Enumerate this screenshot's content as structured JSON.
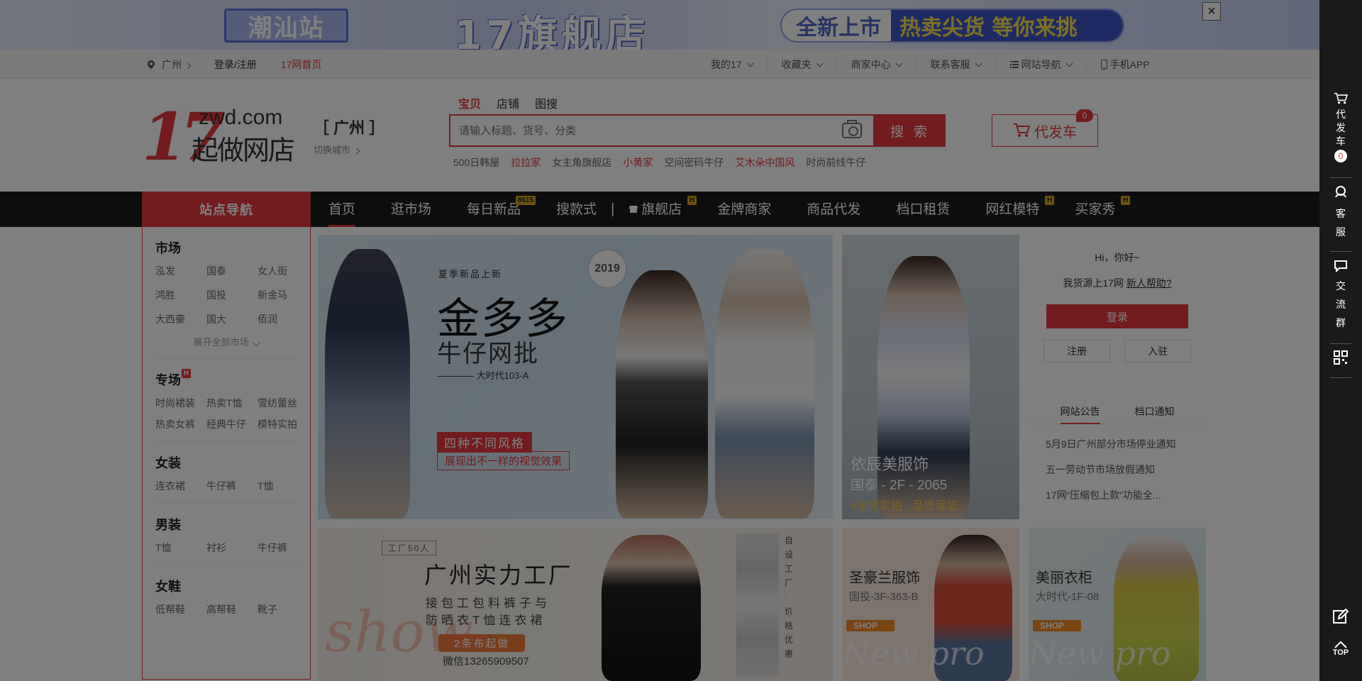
{
  "top_banner": {
    "station": "潮汕站",
    "brand": "17旗舰店",
    "promo_left": "全新上市",
    "promo_right": "热卖尖货 等你来挑",
    "close": "×"
  },
  "site_nav": {
    "city": "广州",
    "login": "登录/注册",
    "home": "17网首页",
    "right_items": [
      "我的17",
      "收藏夹",
      "商家中心",
      "联系客服",
      "网站导航",
      "手机APP"
    ]
  },
  "header": {
    "logo_num": "17",
    "logo_domain": "zwd.com",
    "logo_cn": "起做网店",
    "city_name": "［ 广州 ］",
    "city_switch": "切换城市",
    "search_tabs": [
      "宝贝",
      "店铺",
      "图搜"
    ],
    "search_placeholder": "请输入标题、货号、分类",
    "search_button": "搜 索",
    "hotwords": [
      {
        "text": "500日韩屋",
        "red": false
      },
      {
        "text": "拉拉家",
        "red": true
      },
      {
        "text": "女主角旗舰店",
        "red": false
      },
      {
        "text": "小黄家",
        "red": true
      },
      {
        "text": "空间密码牛仔",
        "red": false
      },
      {
        "text": "艾木朵中国风",
        "red": true
      },
      {
        "text": "时尚前线牛仔",
        "red": false
      }
    ],
    "cart_label": "代发车",
    "cart_count": "0"
  },
  "main_nav": {
    "station_nav": "站点导航",
    "items": [
      {
        "label": "首页",
        "tag": ""
      },
      {
        "label": "逛市场",
        "tag": ""
      },
      {
        "label": "每日新品",
        "tag": "8615"
      },
      {
        "label": "搜款式",
        "tag": ""
      },
      {
        "label": "旗舰店",
        "tag": "H"
      },
      {
        "label": "金牌商家",
        "tag": ""
      },
      {
        "label": "商品代发",
        "tag": ""
      },
      {
        "label": "档口租赁",
        "tag": ""
      },
      {
        "label": "网红模特",
        "tag": "H"
      },
      {
        "label": "买家秀",
        "tag": "H"
      }
    ],
    "separator": "|"
  },
  "side_nav": {
    "groups": [
      {
        "title": "市场",
        "badge": "",
        "links": [
          "泓发",
          "国泰",
          "女人街",
          "鸿胜",
          "国投",
          "新金马",
          "大西豪",
          "国大",
          "佰润"
        ],
        "expand": "展开全部市场"
      },
      {
        "title": "专场",
        "badge": "H",
        "links": [
          "时尚裙装",
          "热卖T恤",
          "雪纺蕾丝",
          "热卖女裤",
          "经典牛仔",
          "模特实拍"
        ],
        "expand": ""
      },
      {
        "title": "女装",
        "badge": "",
        "links": [
          "连衣裙",
          "牛仔裤",
          "T恤"
        ],
        "expand": ""
      },
      {
        "title": "男装",
        "badge": "",
        "links": [
          "T恤",
          "衬衫",
          "牛仔裤"
        ],
        "expand": ""
      },
      {
        "title": "女鞋",
        "badge": "",
        "links": [
          "低帮鞋",
          "高帮鞋",
          "靴子"
        ],
        "expand": ""
      }
    ]
  },
  "banner_main": {
    "year": "2019",
    "subtitle": "夏季新品上新",
    "title": "金多多",
    "title2": "牛仔网批",
    "location": "———— 大时代103-A",
    "tag1": "四种不同风格",
    "tag2": "展现出不一样的视觉效果"
  },
  "banner_side": {
    "shop": "依辰美服饰",
    "addr": "国泰 - 2F - 2065",
    "tagline": "#全店实拍 · 品质保证"
  },
  "user_panel": {
    "greeting": "Hi，你好~",
    "help_prefix": "我货源上17网",
    "help_link": "新人帮助?",
    "login": "登录",
    "register": "注册",
    "settle": "入驻"
  },
  "notice_panel": {
    "tabs": [
      "网站公告",
      "档口通知"
    ],
    "items": [
      "5月9日广州部分市场停业通知",
      "五一劳动节市场放假通知",
      "17网“压缩包上款”功能全..."
    ]
  },
  "banner_b1": {
    "factory": "工厂50人",
    "title": "广州实力工厂",
    "line1": "接包工包料裤子与",
    "line2": "防晒衣T恤连衣裙",
    "pill": "2条布起做",
    "wechat": "微信13265909507",
    "script": "show",
    "vertical": "自设工厂·价格优惠"
  },
  "banner_b2": {
    "name": "圣豪兰服饰",
    "addr": "国投-3F-363-B",
    "shop": "SHOP",
    "script": "New pro"
  },
  "banner_b3": {
    "name": "美丽衣柜",
    "addr": "大时代-1F-08",
    "shop": "SHOP",
    "script": "New pro"
  },
  "right_toolbar": {
    "cart": "代发车",
    "cart_count": "0",
    "service": "客服",
    "group": "交流群",
    "top": "TOP"
  },
  "colors": {
    "accent": "#e4393c",
    "nav_bg": "#1a1a1a",
    "tag": "#d9a615"
  }
}
